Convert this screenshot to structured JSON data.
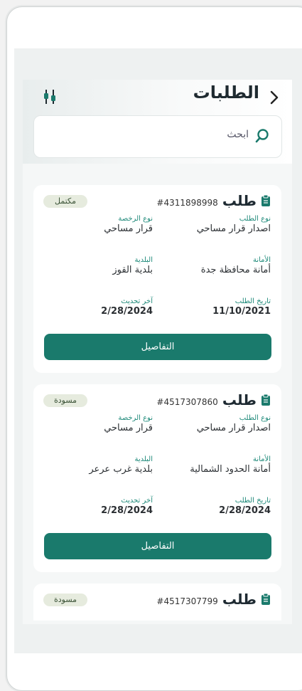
{
  "header": {
    "title": "الطلبات",
    "back_icon": "chevron-right-icon",
    "filter_icon": "filter-sliders-icon"
  },
  "search": {
    "placeholder": "ابحث"
  },
  "colors": {
    "accent": "#1a7a6c",
    "label": "#1f8a7a",
    "badge_bg": "#e6ebde"
  },
  "requests": [
    {
      "word": "طلب",
      "number": "#4311898998",
      "status": "مكتمل",
      "request_type_label": "نوع الطلب",
      "request_type": "اصدار قرار مساحي",
      "license_type_label": "نوع الرخصة",
      "license_type": "قرار مساحي",
      "amanah_label": "الأمانة",
      "amanah": "أمانة محافظة جدة",
      "municipality_label": "البلدية",
      "municipality": "بلدية القوز",
      "request_date_label": "تاريخ الطلب",
      "request_date": "11/10/2021",
      "last_update_label": "آخر تحديث",
      "last_update": "2/28/2024",
      "details_label": "التفاصيل"
    },
    {
      "word": "طلب",
      "number": "#4517307860",
      "status": "مسودة",
      "request_type_label": "نوع الطلب",
      "request_type": "اصدار قرار مساحي",
      "license_type_label": "نوع الرخصة",
      "license_type": "قرار مساحي",
      "amanah_label": "الأمانة",
      "amanah": "أمانة الحدود الشمالية",
      "municipality_label": "البلدية",
      "municipality": "بلدية غرب عرعر",
      "request_date_label": "تاريخ الطلب",
      "request_date": "2/28/2024",
      "last_update_label": "آخر تحديث",
      "last_update": "2/28/2024",
      "details_label": "التفاصيل"
    },
    {
      "word": "طلب",
      "number": "#4517307799",
      "status": "مسودة"
    }
  ]
}
